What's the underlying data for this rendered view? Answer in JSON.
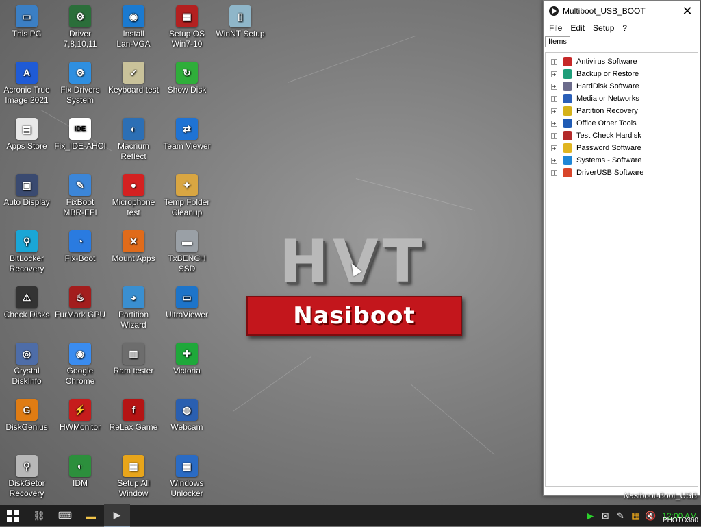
{
  "desktop": {
    "icons": [
      {
        "label": "This PC",
        "icon": "computer-icon",
        "color": "#3b7fc4",
        "glyph": "▭"
      },
      {
        "label": "Driver\n7,8,10,11",
        "icon": "driver-icon",
        "color": "#2b6e3a",
        "glyph": "⚙"
      },
      {
        "label": "Install\nLan-VGA",
        "icon": "wifi-icon",
        "color": "#1b7ad0",
        "glyph": "◉"
      },
      {
        "label": "Setup OS\nWin7-10",
        "icon": "windows-setup-icon",
        "color": "#b32020",
        "glyph": "▦"
      },
      {
        "label": "WinNT Setup",
        "icon": "phone-setup-icon",
        "color": "#8fb6c9",
        "glyph": "▯"
      },
      {
        "label": "Acronic True\nImage 2021",
        "icon": "acronis-icon",
        "color": "#1f5bd6",
        "glyph": "A"
      },
      {
        "label": "Fix Drivers\nSystem",
        "icon": "fix-drivers-icon",
        "color": "#2f8fe0",
        "glyph": "⚙"
      },
      {
        "label": "Keyboard test",
        "icon": "keyboard-test-icon",
        "color": "#c9c29a",
        "glyph": "✓"
      },
      {
        "label": "Show Disk",
        "icon": "refresh-icon",
        "color": "#2fae3a",
        "glyph": "↻"
      },
      {
        "label": "Apps Store",
        "icon": "store-icon",
        "color": "#e8e8e8",
        "glyph": "▤"
      },
      {
        "label": "Fix_IDE-AHCI",
        "icon": "ahci-ide-icon",
        "color": "#ffffff",
        "glyph": "IDE"
      },
      {
        "label": "Macrium\nReflect",
        "icon": "macrium-icon",
        "color": "#2c6fb5",
        "glyph": "◐"
      },
      {
        "label": "Team Viewer",
        "icon": "teamviewer-icon",
        "color": "#1f73d4",
        "glyph": "⇄"
      },
      {
        "label": "Auto Display",
        "icon": "display-icon",
        "color": "#3a4a70",
        "glyph": "▣"
      },
      {
        "label": "FixBoot\nMBR-EFI",
        "icon": "wrench-icon",
        "color": "#3c86d8",
        "glyph": "✎"
      },
      {
        "label": "Microphone\ntest",
        "icon": "microphone-icon",
        "color": "#d42121",
        "glyph": "●"
      },
      {
        "label": "Temp Folder\nCleanup",
        "icon": "broom-icon",
        "color": "#d9a642",
        "glyph": "✦"
      },
      {
        "label": "BitLocker\nRecovery",
        "icon": "bitlocker-icon",
        "color": "#1aa6d6",
        "glyph": "⚲"
      },
      {
        "label": "Fix-Boot",
        "icon": "fix-boot-icon",
        "color": "#2a7be0",
        "glyph": "◔"
      },
      {
        "label": "Mount Apps",
        "icon": "tools-icon",
        "color": "#e06b1a",
        "glyph": "✕"
      },
      {
        "label": "TxBENCH SSD",
        "icon": "ssd-icon",
        "color": "#9aa0a6",
        "glyph": "▬"
      },
      {
        "label": "Check Disks",
        "icon": "warning-drive-icon",
        "color": "#333333",
        "glyph": "⚠"
      },
      {
        "label": "FurMark GPU",
        "icon": "furmark-icon",
        "color": "#a31d1d",
        "glyph": "♨"
      },
      {
        "label": "Partition\nWizard",
        "icon": "partition-wizard-icon",
        "color": "#3a8fd0",
        "glyph": "◕"
      },
      {
        "label": "UltraViewer",
        "icon": "ultraviewer-icon",
        "color": "#1d74c9",
        "glyph": "▭"
      },
      {
        "label": "Crystal\nDiskInfo",
        "icon": "crystaldiskinfo-icon",
        "color": "#4e6da8",
        "glyph": "◎"
      },
      {
        "label": "Google\nChrome",
        "icon": "chrome-icon",
        "color": "#3a8cf0",
        "glyph": "◉"
      },
      {
        "label": "Ram tester",
        "icon": "ram-icon",
        "color": "#6d6d6d",
        "glyph": "▥"
      },
      {
        "label": "Victoria",
        "icon": "victoria-icon",
        "color": "#1fa83a",
        "glyph": "✚"
      },
      {
        "label": "DiskGenius",
        "icon": "diskgenius-icon",
        "color": "#e07c13",
        "glyph": "G"
      },
      {
        "label": "HWMonitor",
        "icon": "hwmonitor-icon",
        "color": "#c61c1c",
        "glyph": "⚡"
      },
      {
        "label": "ReLax Game",
        "icon": "flash-icon",
        "color": "#b51414",
        "glyph": "f"
      },
      {
        "label": "Webcam",
        "icon": "webcam-icon",
        "color": "#2a5fb0",
        "glyph": "◍"
      },
      {
        "label": "DiskGetor\nRecovery",
        "icon": "diskgetor-icon",
        "color": "#b8b8b8",
        "glyph": "⚲"
      },
      {
        "label": "IDM",
        "icon": "idm-icon",
        "color": "#2c8f3c",
        "glyph": "◐"
      },
      {
        "label": "Setup All\nWindow",
        "icon": "setup-all-icon",
        "color": "#e8a51a",
        "glyph": "▦"
      },
      {
        "label": "Windows\nUnlocker",
        "icon": "windows-unlocker-icon",
        "color": "#2a6bc4",
        "glyph": "▦"
      }
    ],
    "logo_title": "HVT",
    "logo_subtitle": "Nasiboot"
  },
  "window": {
    "title": "Multiboot_USB_BOOT",
    "close_glyph": "✕",
    "menu": [
      "File",
      "Edit",
      "Setup",
      "?"
    ],
    "tab": "Items",
    "tree": [
      {
        "label": "Antivirus Software",
        "color": "#c62828"
      },
      {
        "label": "Backup or Restore",
        "color": "#1e9e7a"
      },
      {
        "label": "HardDisk Software",
        "color": "#6c6c8c"
      },
      {
        "label": "Media or Networks",
        "color": "#2a5fb8"
      },
      {
        "label": "Partition Recovery",
        "color": "#d5b21b"
      },
      {
        "label": "Office Other Tools",
        "color": "#1f5bb5"
      },
      {
        "label": "Test Check Hardisk",
        "color": "#b32a2a"
      },
      {
        "label": "Password Software",
        "color": "#e0b520"
      },
      {
        "label": "Systems - Software",
        "color": "#1f86d6"
      },
      {
        "label": "DriverUSB Software",
        "color": "#d8452a"
      }
    ],
    "expand_glyph": "+"
  },
  "watermark": {
    "line1": "Nasiboot-Boot_USB",
    "photo": "PHOTO360"
  },
  "taskbar": {
    "clock": "12:00 AM"
  }
}
